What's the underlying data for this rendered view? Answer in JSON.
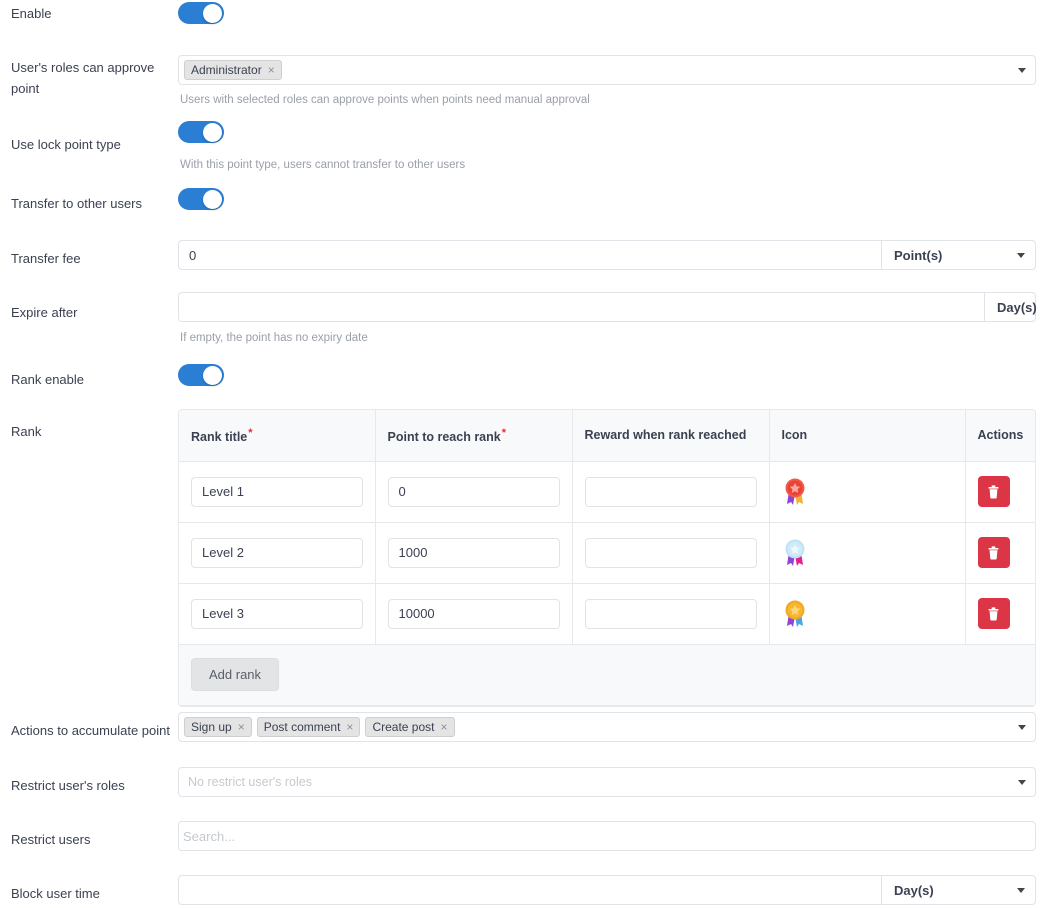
{
  "colors": {
    "toggle_on": "#2a7fd4",
    "delete_btn": "#dc3545",
    "required_star": "#e12d39",
    "header_bg": "#f8f9fa"
  },
  "fields": {
    "enable": {
      "label": "Enable",
      "toggle_state": "on"
    },
    "approve_roles": {
      "label": "User's roles can approve point",
      "label_line1": "User's roles can approve",
      "label_line2": "point",
      "selected_tags": [
        "Administrator"
      ],
      "help": "Users with selected roles can approve points when points need manual approval"
    },
    "lock_point_type": {
      "label": "Use lock point type",
      "toggle_state": "on",
      "help": "With this point type, users cannot transfer to other users"
    },
    "transfer_to_other_users": {
      "label": "Transfer to other users",
      "toggle_state": "on"
    },
    "transfer_fee": {
      "label": "Transfer fee",
      "value": "0",
      "unit": "Point(s)"
    },
    "expire_after": {
      "label": "Expire after",
      "value": "",
      "unit": "Day(s)",
      "help": "If empty, the point has no expiry date"
    },
    "rank_enable": {
      "label": "Rank enable",
      "toggle_state": "on"
    },
    "rank": {
      "label": "Rank",
      "columns": [
        "Rank title",
        "Point to reach rank",
        "Reward when rank reached",
        "Icon",
        "Actions"
      ],
      "required_columns": [
        true,
        true,
        false,
        false,
        false
      ],
      "rows": [
        {
          "title": "Level 1",
          "point": "0",
          "reward": "",
          "icon": "medal-red-icon",
          "action": "delete-rank-button"
        },
        {
          "title": "Level 2",
          "point": "1000",
          "reward": "",
          "icon": "medal-blue-icon",
          "action": "delete-rank-button"
        },
        {
          "title": "Level 3",
          "point": "10000",
          "reward": "",
          "icon": "medal-gold-icon",
          "action": "delete-rank-button"
        }
      ],
      "add_button": "Add rank"
    },
    "actions_accumulate": {
      "label": "Actions to accumulate point",
      "selected_tags": [
        "Sign up",
        "Post comment",
        "Create post"
      ]
    },
    "restrict_roles": {
      "label": "Restrict user's roles",
      "placeholder": "No restrict user's roles"
    },
    "restrict_users": {
      "label": "Restrict users",
      "placeholder": "Search..."
    },
    "block_user_time": {
      "label": "Block user time",
      "value": "",
      "unit": "Day(s)"
    }
  },
  "icons": {
    "remove_tag": "×",
    "trash": "trash-icon",
    "caret_down": "chevron-down-icon"
  }
}
